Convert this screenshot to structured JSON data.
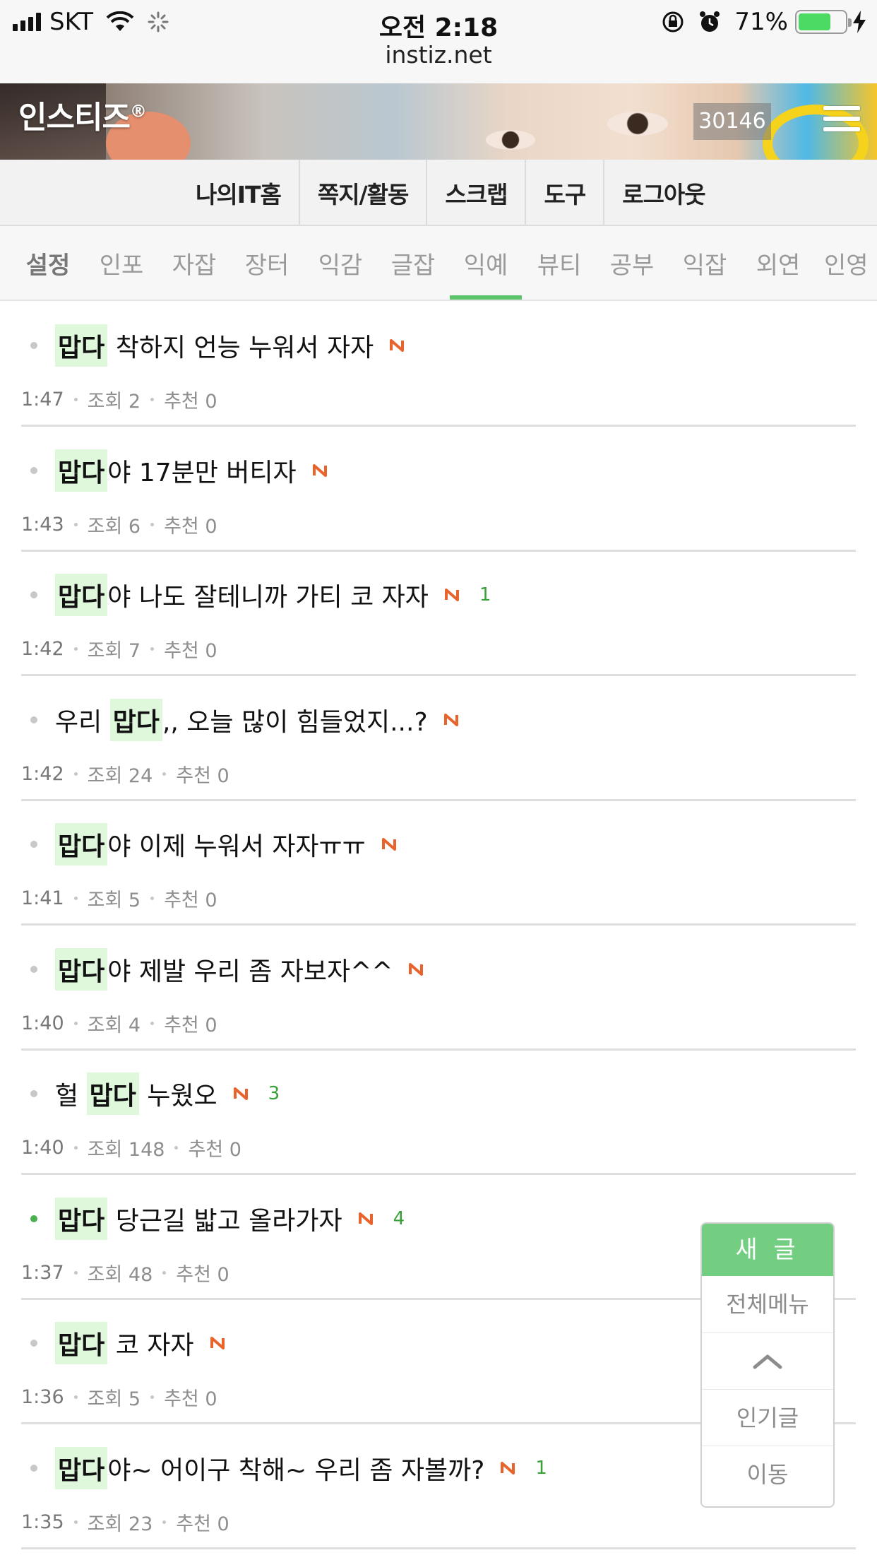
{
  "status_bar": {
    "carrier": "SKT",
    "time": "오전 2:18",
    "url": "instiz.net",
    "battery_percent": "71%",
    "battery_level": 0.71
  },
  "header": {
    "logo": "인스티즈",
    "logo_mark": "®",
    "counter": "30146"
  },
  "top_nav": [
    "나의IT홈",
    "쪽지/활동",
    "스크랩",
    "도구",
    "로그아웃"
  ],
  "tabs": [
    {
      "label": "설정"
    },
    {
      "label": "인포"
    },
    {
      "label": "자잡"
    },
    {
      "label": "장터"
    },
    {
      "label": "익감"
    },
    {
      "label": "글잡"
    },
    {
      "label": "익예"
    },
    {
      "label": "뷰티"
    },
    {
      "label": "공부"
    },
    {
      "label": "익잡"
    },
    {
      "label": "외연"
    },
    {
      "label": "인영"
    }
  ],
  "active_tab": "익예",
  "posts": [
    {
      "pre": "",
      "hl": "맙다",
      "post": " 착하지 언능 누워서 자자",
      "comments": "",
      "time": "1:47",
      "views": "조회 2",
      "likes": "추천 0"
    },
    {
      "pre": "",
      "hl": "맙다",
      "post": "야 17분만 버티자",
      "comments": "",
      "time": "1:43",
      "views": "조회 6",
      "likes": "추천 0"
    },
    {
      "pre": "",
      "hl": "맙다",
      "post": "야 나도 잘테니까 가티 코 자자",
      "comments": "1",
      "time": "1:42",
      "views": "조회 7",
      "likes": "추천 0"
    },
    {
      "pre": "우리 ",
      "hl": "맙다",
      "post": ",, 오늘 많이 힘들었지...?",
      "comments": "",
      "time": "1:42",
      "views": "조회 24",
      "likes": "추천 0"
    },
    {
      "pre": "",
      "hl": "맙다",
      "post": "야 이제 누워서 자자ㅠㅠ",
      "comments": "",
      "time": "1:41",
      "views": "조회 5",
      "likes": "추천 0"
    },
    {
      "pre": "",
      "hl": "맙다",
      "post": "야 제발 우리 좀 자보자^^",
      "comments": "",
      "time": "1:40",
      "views": "조회 4",
      "likes": "추천 0"
    },
    {
      "pre": "헐 ",
      "hl": "맙다",
      "post": " 누웠오",
      "comments": "3",
      "time": "1:40",
      "views": "조회 148",
      "likes": "추천 0"
    },
    {
      "pre": "",
      "hl": "맙다",
      "post": " 당근길 밟고 올라가자",
      "comments": "4",
      "time": "1:37",
      "views": "조회 48",
      "likes": "추천 0"
    },
    {
      "pre": "",
      "hl": "맙다",
      "post": " 코 자자",
      "comments": "",
      "time": "1:36",
      "views": "조회 5",
      "likes": "추천 0"
    },
    {
      "pre": "",
      "hl": "맙다",
      "post": "야~ 어이구 착해~ 우리 좀 자볼까?",
      "comments": "1",
      "time": "1:35",
      "views": "조회 23",
      "likes": "추천 0"
    }
  ],
  "float_menu": {
    "new_post": "새 글",
    "all_menu": "전체메뉴",
    "popular": "인기글",
    "move": "이동"
  },
  "colors": {
    "accent_green": "#5cc46a",
    "highlight": "#dff8dc",
    "new_badge": "#e8642c",
    "comment_count": "#3aa03a"
  }
}
